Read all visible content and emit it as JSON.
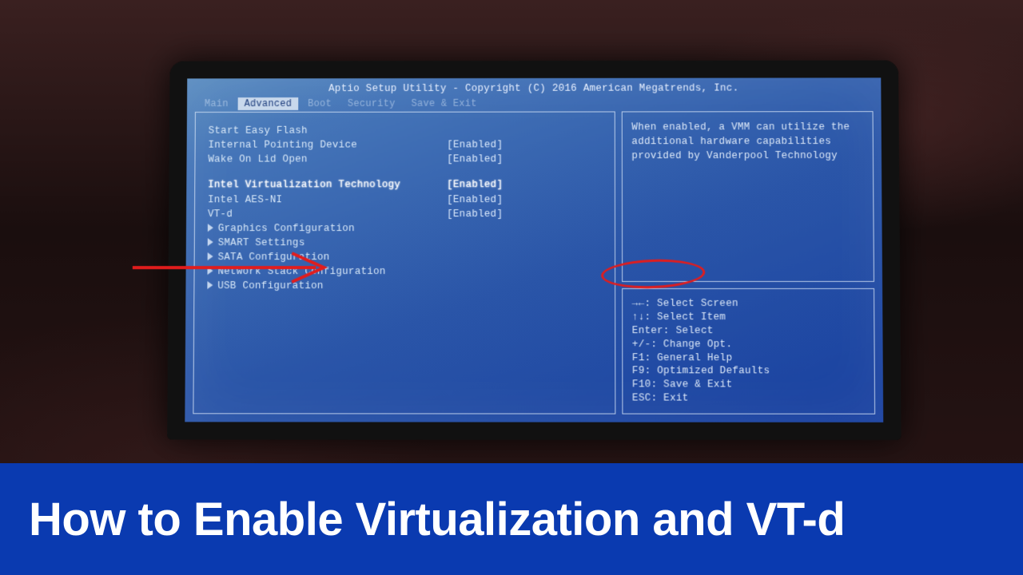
{
  "header": {
    "title": "Aptio Setup Utility - Copyright (C) 2016 American Megatrends, Inc."
  },
  "tabs": {
    "items": [
      "Main",
      "Advanced",
      "Boot",
      "Security",
      "Save & Exit"
    ],
    "active_index": 1
  },
  "settings": {
    "group1": [
      {
        "label": "Start Easy Flash",
        "value": ""
      },
      {
        "label": "Internal Pointing Device",
        "value": "[Enabled]"
      },
      {
        "label": "Wake On Lid Open",
        "value": "[Enabled]"
      }
    ],
    "group2": [
      {
        "label": "Intel Virtualization Technology",
        "value": "[Enabled]",
        "selected": true
      },
      {
        "label": "Intel AES-NI",
        "value": "[Enabled]"
      },
      {
        "label": "VT-d",
        "value": "[Enabled]"
      }
    ],
    "submenus": [
      "Graphics Configuration",
      "SMART Settings",
      "SATA Configuration",
      "Network Stack Configuration",
      "USB Configuration"
    ]
  },
  "help": {
    "text": "When enabled, a VMM can utilize the additional hardware capabilities provided by Vanderpool Technology"
  },
  "hints": [
    "→←: Select Screen",
    "↑↓: Select Item",
    "Enter: Select",
    "+/-: Change Opt.",
    "F1: General Help",
    "F9: Optimized Defaults",
    "F10: Save & Exit",
    "ESC: Exit"
  ],
  "banner": {
    "text": "How to Enable Virtualization and VT-d"
  }
}
